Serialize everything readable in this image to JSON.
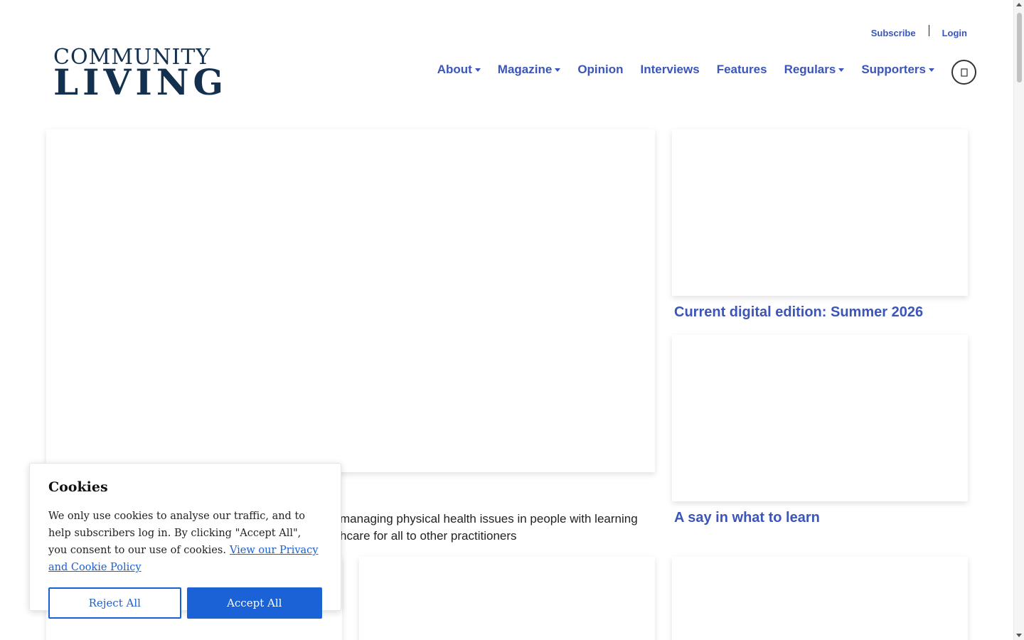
{
  "header": {
    "utility_links": {
      "subscribe": "Subscribe",
      "login": "Login"
    },
    "logo": {
      "line1": "COMMUNITY",
      "line2": "LIVING"
    },
    "nav": [
      {
        "label": "About",
        "dropdown": true
      },
      {
        "label": "Magazine",
        "dropdown": true
      },
      {
        "label": "Opinion",
        "dropdown": false
      },
      {
        "label": "Interviews",
        "dropdown": false
      },
      {
        "label": "Features",
        "dropdown": false
      },
      {
        "label": "Regulars",
        "dropdown": true
      },
      {
        "label": "Supporters",
        "dropdown": true
      }
    ],
    "search_icon": "magnifier-icon"
  },
  "main": {
    "side_cards": [
      {
        "title": "Current digital edition: Summer 2026"
      },
      {
        "title": "A say in what to learn"
      }
    ],
    "feature_excerpt": "managing physical health issues in people with learning hcare for all to other practitioners"
  },
  "cookie_banner": {
    "title": "Cookies",
    "message": "We only use cookies to analyse our traffic, and to help subscribers log in. By clicking \"Accept All\", you consent to our use of cookies.",
    "policy_link": "View our Privacy and Cookie Policy",
    "reject_label": "Reject All",
    "accept_label": "Accept All"
  },
  "colors": {
    "link": "#3b55b8",
    "logo": "#14304f",
    "accept": "#1a62d6"
  }
}
